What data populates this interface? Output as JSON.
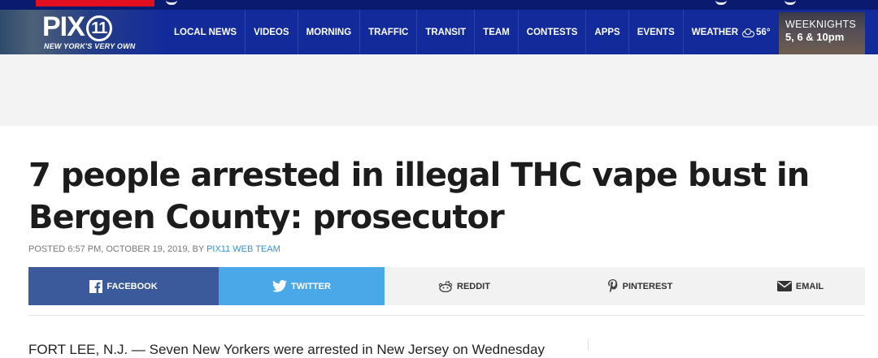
{
  "site": {
    "logo_text": "PIX",
    "logo_number": "11",
    "tagline": "NEW YORK'S VERY OWN"
  },
  "nav": {
    "items": [
      "LOCAL NEWS",
      "VIDEOS",
      "MORNING",
      "TRAFFIC",
      "TRANSIT",
      "TEAM",
      "CONTESTS",
      "APPS",
      "EVENTS"
    ],
    "weather_label": "WEATHER",
    "weather_temp": "56°",
    "weather_icon": "partly-cloudy-icon"
  },
  "promo": {
    "line1": "WEEKNIGHTS",
    "line2": "5, 6 & 10pm"
  },
  "article": {
    "headline": "7 people arrested in illegal THC vape bust in Bergen County: prosecutor",
    "byline_prefix": "POSTED 6:57 PM, OCTOBER 19, 2019, BY ",
    "byline_author": "PIX11 WEB TEAM",
    "body_start": "FORT LEE, N.J. — Seven New Yorkers were arrested in New Jersey on Wednesday"
  },
  "share": {
    "facebook": "FACEBOOK",
    "twitter": "TWITTER",
    "reddit": "REDDIT",
    "pinterest": "PINTEREST",
    "email": "EMAIL"
  },
  "colors": {
    "nav_bg": "#132b9a",
    "top_bar": "#0a1a6e",
    "facebook": "#3b5a9c",
    "twitter": "#4aa7e8",
    "link": "#3a8fd0"
  }
}
